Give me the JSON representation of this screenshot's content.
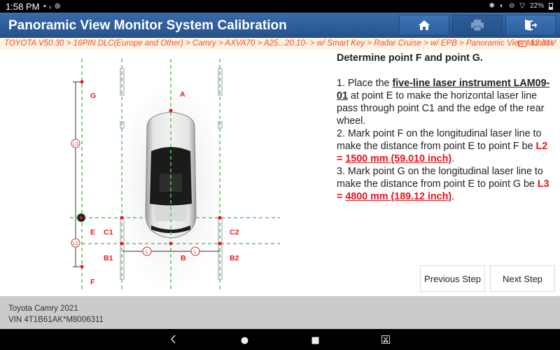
{
  "status_bar": {
    "time": "1:58 PM",
    "left_icons": [
      "image-icon",
      "usb-icon",
      "vci-icon"
    ],
    "right_icons": [
      "bluetooth-icon",
      "vibrate-icon",
      "do-not-disturb-icon",
      "wifi-icon"
    ],
    "battery": "22%"
  },
  "header": {
    "title": "Panoramic View Monitor System Calibration",
    "buttons": [
      {
        "name": "home",
        "icon": "home-icon"
      },
      {
        "name": "print",
        "icon": "printer-icon"
      },
      {
        "name": "exit",
        "icon": "exit-icon"
      }
    ],
    "accent_color": "#2d5f9e"
  },
  "breadcrumb": {
    "path": "TOYOTA V50.30 > 16PIN DLC(Europe and Other) > Camry > AXVA70 > A25...20.10- > w/ Smart Key > Radar Cruise > w/ EPB > Panoramic View Monitor",
    "voltage": "12.31V",
    "color": "#f0522a"
  },
  "diagram": {
    "points": {
      "A": "A",
      "B": "B",
      "B1": "B1",
      "B2": "B2",
      "C1": "C1",
      "C2": "C2",
      "E": "E",
      "F": "F",
      "G": "G"
    },
    "dimension_labels": {
      "L": "L",
      "L2": "L2",
      "L3": "L3"
    }
  },
  "instructions": {
    "heading": "Determine point F and point G.",
    "step1": {
      "prefix": "1. Place the ",
      "instrument": "five-line laser instrument LAM09-01",
      "suffix": " at point E to make the horizontal laser line pass through point C1 and the edge of the rear wheel."
    },
    "step2": {
      "text": "2. Mark point F on the longitudinal laser line to make the distance from point E to point F be ",
      "label": "L2 = ",
      "value": "1500 mm (59.010 inch)",
      "end": "."
    },
    "step3": {
      "text": "3. Mark point G on the longitudinal laser line to make the distance from point E to point G be ",
      "label": "L3 = ",
      "value": "4800 mm (189.12 inch)",
      "end": "."
    }
  },
  "buttons": {
    "previous": "Previous Step",
    "next": "Next Step"
  },
  "footer": {
    "vehicle": "Toyota Camry 2021",
    "vin": "VIN 4T1B61AK*M8006311"
  },
  "system_nav": [
    "back-icon",
    "home-circle-icon",
    "recents-icon",
    "screenshot-icon"
  ]
}
